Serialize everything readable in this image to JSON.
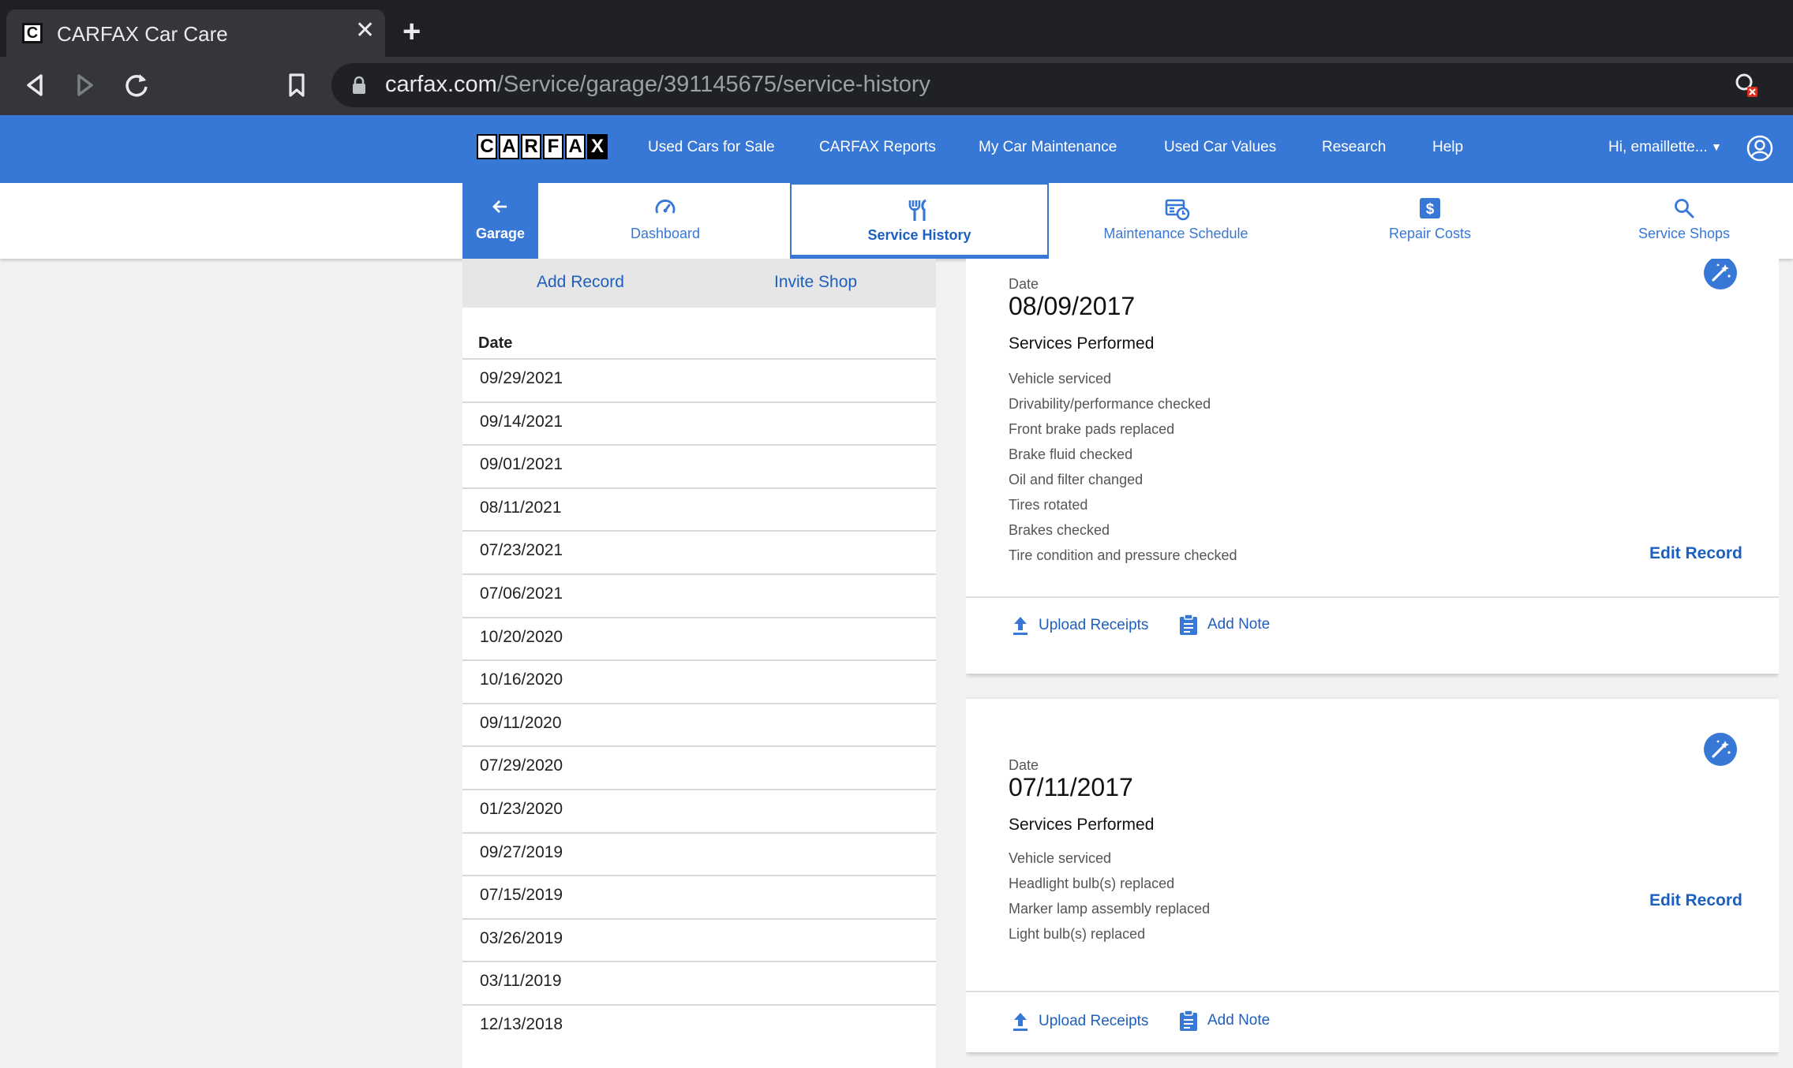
{
  "browser": {
    "tab_title": "CARFAX Car Care",
    "favicon_letter": "C",
    "new_tab_glyph": "+",
    "close_glyph": "✕",
    "url_host": "carfax.com",
    "url_path": "/Service/garage/391145675/service-history"
  },
  "header": {
    "logo_letters": [
      "C",
      "A",
      "R",
      "F",
      "A",
      "X"
    ],
    "nav": [
      {
        "label": "Used Cars for Sale"
      },
      {
        "label": "CARFAX Reports"
      },
      {
        "label": "My Car Maintenance"
      },
      {
        "label": "Used Car Values"
      },
      {
        "label": "Research"
      },
      {
        "label": "Help"
      }
    ],
    "user_greeting": "Hi, emaillette...",
    "accent": "#3777d5"
  },
  "subnav": {
    "garage_label": "Garage",
    "tabs": [
      {
        "label": "Dashboard",
        "icon": "speedometer-icon"
      },
      {
        "label": "Service History",
        "icon": "tools-icon",
        "active": true
      },
      {
        "label": "Maintenance Schedule",
        "icon": "calendar-clock-icon"
      },
      {
        "label": "Repair Costs",
        "icon": "dollar-icon"
      },
      {
        "label": "Service Shops",
        "icon": "search-icon"
      }
    ]
  },
  "left_panel": {
    "add_record": "Add Record",
    "invite_shop": "Invite Shop",
    "date_header": "Date",
    "dates": [
      "09/29/2021",
      "09/14/2021",
      "09/01/2021",
      "08/11/2021",
      "07/23/2021",
      "07/06/2021",
      "10/20/2020",
      "10/16/2020",
      "09/11/2020",
      "07/29/2020",
      "01/23/2020",
      "09/27/2019",
      "07/15/2019",
      "03/26/2019",
      "03/11/2019",
      "12/13/2018"
    ]
  },
  "records": [
    {
      "date_label": "Date",
      "date": "08/09/2017",
      "services_title": "Services Performed",
      "services": [
        "Vehicle serviced",
        "Drivability/performance checked",
        "Front brake pads replaced",
        "Brake fluid checked",
        "Oil and filter changed",
        "Tires rotated",
        "Brakes checked",
        "Tire condition and pressure checked"
      ],
      "edit_label": "Edit Record",
      "upload_label": "Upload Receipts",
      "note_label": "Add Note"
    },
    {
      "date_label": "Date",
      "date": "07/11/2017",
      "services_title": "Services Performed",
      "services": [
        "Vehicle serviced",
        "Headlight bulb(s) replaced",
        "Marker lamp assembly replaced",
        "Light bulb(s) replaced"
      ],
      "edit_label": "Edit Record",
      "upload_label": "Upload Receipts",
      "note_label": "Add Note"
    }
  ]
}
